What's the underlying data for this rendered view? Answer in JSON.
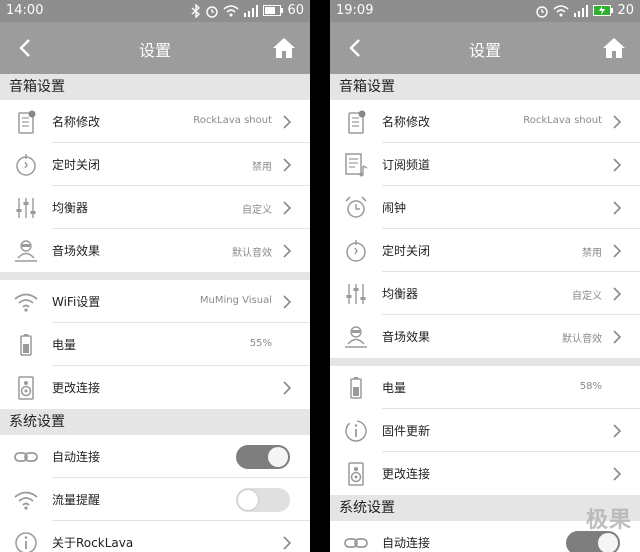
{
  "left": {
    "status": {
      "time": "14:00",
      "battery": "60"
    },
    "title": "设置",
    "sections": [
      {
        "header": "音箱设置",
        "rows": [
          {
            "icon": "speaker-rename-icon",
            "label": "名称修改",
            "value": "RockLava shout",
            "chevron": true
          },
          {
            "icon": "timer-off-icon",
            "label": "定时关闭",
            "value": "禁用",
            "chevron": true
          },
          {
            "icon": "equalizer-icon",
            "label": "均衡器",
            "value": "自定义",
            "chevron": true
          },
          {
            "icon": "sound-effect-icon",
            "label": "音场效果",
            "value": "默认音效",
            "chevron": true
          }
        ]
      },
      {
        "header": "",
        "rows": [
          {
            "icon": "wifi-icon",
            "label": "WiFi设置",
            "value": "MuMing Visual",
            "chevron": true
          },
          {
            "icon": "battery-icon",
            "label": "电量",
            "value": "55%",
            "chevron": false
          },
          {
            "icon": "speaker-icon",
            "label": "更改连接",
            "value": "",
            "chevron": true
          }
        ]
      },
      {
        "header": "系统设置",
        "rows": [
          {
            "icon": "link-icon",
            "label": "自动连接",
            "toggle": "on"
          },
          {
            "icon": "wifi-icon",
            "label": "流量提醒",
            "toggle": "off"
          },
          {
            "icon": "info-icon",
            "label": "关于RockLava",
            "value": "",
            "chevron": true
          }
        ]
      }
    ]
  },
  "right": {
    "status": {
      "time": "19:09",
      "battery": "20"
    },
    "title": "设置",
    "sections": [
      {
        "header": "音箱设置",
        "rows": [
          {
            "icon": "speaker-rename-icon",
            "label": "名称修改",
            "value": "RockLava shout",
            "chevron": true
          },
          {
            "icon": "subscribe-channel-icon",
            "label": "订阅频道",
            "value": "",
            "chevron": true
          },
          {
            "icon": "alarm-clock-icon",
            "label": "闹钟",
            "value": "",
            "chevron": true
          },
          {
            "icon": "timer-off-icon",
            "label": "定时关闭",
            "value": "禁用",
            "chevron": true
          },
          {
            "icon": "equalizer-icon",
            "label": "均衡器",
            "value": "自定义",
            "chevron": true
          },
          {
            "icon": "sound-effect-icon",
            "label": "音场效果",
            "value": "默认音效",
            "chevron": true
          }
        ]
      },
      {
        "header": "",
        "rows": [
          {
            "icon": "battery-icon",
            "label": "电量",
            "value": "58%",
            "chevron": false
          },
          {
            "icon": "firmware-update-icon",
            "label": "固件更新",
            "value": "",
            "chevron": true
          },
          {
            "icon": "speaker-icon",
            "label": "更改连接",
            "value": "",
            "chevron": true
          }
        ]
      },
      {
        "header": "系统设置",
        "rows": [
          {
            "icon": "link-icon",
            "label": "自动连接",
            "toggle": "on"
          }
        ]
      }
    ]
  },
  "watermark": "极果",
  "colors": {
    "statusbar": "#8e8e8e",
    "titlebar": "#9c9c9c",
    "section": "#e5e5e5",
    "toggle_on": "#7e7e7e"
  }
}
